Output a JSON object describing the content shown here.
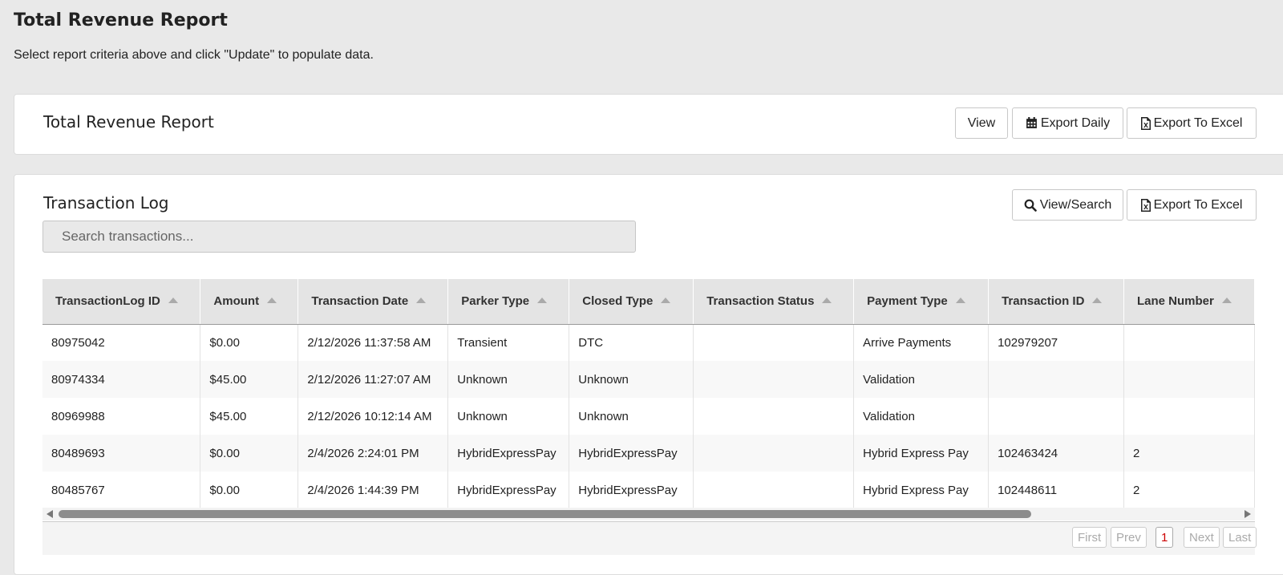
{
  "page": {
    "title": "Total Revenue Report",
    "subtitle": "Select report criteria above and click \"Update\" to populate data."
  },
  "report_card": {
    "title": "Total Revenue Report",
    "view_label": "View",
    "export_daily_label": "Export Daily",
    "export_excel_label": "Export To Excel"
  },
  "log_card": {
    "title": "Transaction Log",
    "view_search_label": "View/Search",
    "export_excel_label": "Export To Excel",
    "search_placeholder": "Search transactions..."
  },
  "table": {
    "columns": [
      "TransactionLog ID",
      "Amount",
      "Transaction Date",
      "Parker Type",
      "Closed Type",
      "Transaction Status",
      "Payment Type",
      "Transaction ID",
      "Lane Number"
    ],
    "rows": [
      [
        "80975042",
        "$0.00",
        "2/12/2026 11:37:58 AM",
        "Transient",
        "DTC",
        "",
        "Arrive Payments",
        "102979207",
        ""
      ],
      [
        "80974334",
        "$45.00",
        "2/12/2026 11:27:07 AM",
        "Unknown",
        "Unknown",
        "",
        "Validation",
        "",
        ""
      ],
      [
        "80969988",
        "$45.00",
        "2/12/2026 10:12:14 AM",
        "Unknown",
        "Unknown",
        "",
        "Validation",
        "",
        ""
      ],
      [
        "80489693",
        "$0.00",
        "2/4/2026 2:24:01 PM",
        "HybridExpressPay",
        "HybridExpressPay",
        "",
        "Hybrid Express Pay",
        "102463424",
        "2"
      ],
      [
        "80485767",
        "$0.00",
        "2/4/2026 1:44:39 PM",
        "HybridExpressPay",
        "HybridExpressPay",
        "",
        "Hybrid Express Pay",
        "102448611",
        "2"
      ]
    ]
  },
  "pager": {
    "first": "First",
    "prev": "Prev",
    "current": "1",
    "next": "Next",
    "last": "Last"
  },
  "icons": {
    "calendar": "calendar-icon",
    "excel": "excel-file-icon",
    "search": "search-icon"
  }
}
